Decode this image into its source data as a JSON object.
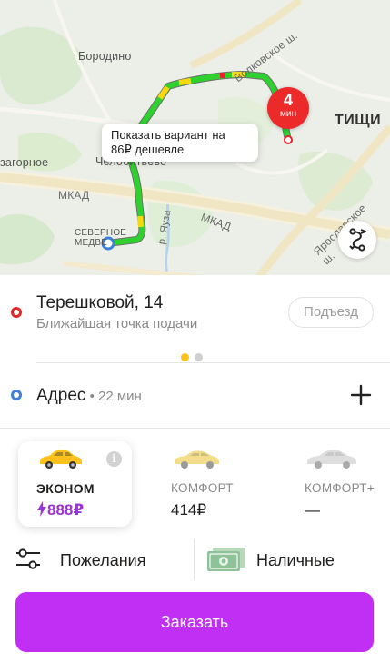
{
  "map": {
    "labels": {
      "borodino": "Бородино",
      "volkovskoe": "Волковское ш.",
      "mytishchi": "ТИЩИ",
      "zagornoe": "загорное",
      "chelobitevo": "Челобитьево",
      "mkad_left": "МКАД",
      "mkad_right": "МКАД",
      "yauza": "р. Яуза",
      "yaroslavskoe": "Ярославское ш.",
      "severnoe": "СЕВЕРНОЕ",
      "medvedkovo": "МЕДВЕ"
    },
    "tooltip": {
      "line1": "Показать вариант на",
      "line2": "86₽ дешевле"
    },
    "eta": {
      "value": "4",
      "unit": "мин"
    },
    "colors": {
      "route_green": "#2ed12e",
      "route_yellow": "#f5d90a",
      "route_red": "#e8232a",
      "pin": "#ec2a2a"
    }
  },
  "pickup": {
    "title": "Терешковой, 14",
    "subtitle": "Ближайшая точка подачи",
    "entrance_label": "Подъезд"
  },
  "pager": {
    "active_color": "#fbc31a",
    "inactive_color": "#d0d0d0"
  },
  "destination": {
    "title": "Адрес",
    "eta": " • 22 мин"
  },
  "tariffs": [
    {
      "name": "ЭКОНОМ",
      "price": "888₽",
      "selected": true,
      "surge": true,
      "car_color": "#fbc31a"
    },
    {
      "name": "КОМФОРТ",
      "price": "414₽",
      "selected": false,
      "car_color": "#f3dc8b"
    },
    {
      "name": "КОМФОРТ+",
      "price": "—",
      "selected": false,
      "car_color": "#dedede"
    }
  ],
  "actions": {
    "wishes_label": "Пожелания",
    "payment_label": "Наличные"
  },
  "order_button": {
    "label": "Заказать",
    "color": "#c12ff5"
  }
}
